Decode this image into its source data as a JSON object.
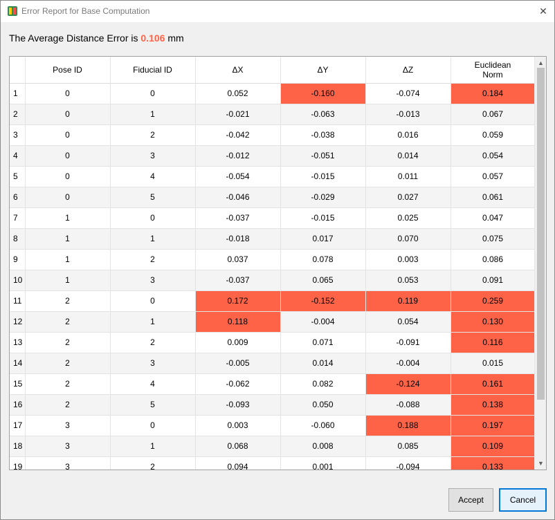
{
  "window": {
    "title": "Error Report for Base Computation"
  },
  "summary": {
    "prefix": "The Average Distance Error is",
    "value": "0.106",
    "unit": "mm"
  },
  "table": {
    "headers": [
      "",
      "Pose ID",
      "Fiducial ID",
      "ΔX",
      "ΔY",
      "ΔZ",
      "Euclidean Norm"
    ],
    "rows": [
      {
        "n": "1",
        "cells": [
          "0",
          "0",
          "0.052",
          "-0.160",
          "-0.074",
          "0.184"
        ],
        "hl": [
          false,
          false,
          false,
          true,
          false,
          true
        ]
      },
      {
        "n": "2",
        "cells": [
          "0",
          "1",
          "-0.021",
          "-0.063",
          "-0.013",
          "0.067"
        ],
        "hl": [
          false,
          false,
          false,
          false,
          false,
          false
        ]
      },
      {
        "n": "3",
        "cells": [
          "0",
          "2",
          "-0.042",
          "-0.038",
          "0.016",
          "0.059"
        ],
        "hl": [
          false,
          false,
          false,
          false,
          false,
          false
        ]
      },
      {
        "n": "4",
        "cells": [
          "0",
          "3",
          "-0.012",
          "-0.051",
          "0.014",
          "0.054"
        ],
        "hl": [
          false,
          false,
          false,
          false,
          false,
          false
        ]
      },
      {
        "n": "5",
        "cells": [
          "0",
          "4",
          "-0.054",
          "-0.015",
          "0.011",
          "0.057"
        ],
        "hl": [
          false,
          false,
          false,
          false,
          false,
          false
        ]
      },
      {
        "n": "6",
        "cells": [
          "0",
          "5",
          "-0.046",
          "-0.029",
          "0.027",
          "0.061"
        ],
        "hl": [
          false,
          false,
          false,
          false,
          false,
          false
        ]
      },
      {
        "n": "7",
        "cells": [
          "1",
          "0",
          "-0.037",
          "-0.015",
          "0.025",
          "0.047"
        ],
        "hl": [
          false,
          false,
          false,
          false,
          false,
          false
        ]
      },
      {
        "n": "8",
        "cells": [
          "1",
          "1",
          "-0.018",
          "0.017",
          "0.070",
          "0.075"
        ],
        "hl": [
          false,
          false,
          false,
          false,
          false,
          false
        ]
      },
      {
        "n": "9",
        "cells": [
          "1",
          "2",
          "0.037",
          "0.078",
          "0.003",
          "0.086"
        ],
        "hl": [
          false,
          false,
          false,
          false,
          false,
          false
        ]
      },
      {
        "n": "10",
        "cells": [
          "1",
          "3",
          "-0.037",
          "0.065",
          "0.053",
          "0.091"
        ],
        "hl": [
          false,
          false,
          false,
          false,
          false,
          false
        ]
      },
      {
        "n": "11",
        "cells": [
          "2",
          "0",
          "0.172",
          "-0.152",
          "0.119",
          "0.259"
        ],
        "hl": [
          false,
          false,
          true,
          true,
          true,
          true
        ]
      },
      {
        "n": "12",
        "cells": [
          "2",
          "1",
          "0.118",
          "-0.004",
          "0.054",
          "0.130"
        ],
        "hl": [
          false,
          false,
          true,
          false,
          false,
          true
        ]
      },
      {
        "n": "13",
        "cells": [
          "2",
          "2",
          "0.009",
          "0.071",
          "-0.091",
          "0.116"
        ],
        "hl": [
          false,
          false,
          false,
          false,
          false,
          true
        ]
      },
      {
        "n": "14",
        "cells": [
          "2",
          "3",
          "-0.005",
          "0.014",
          "-0.004",
          "0.015"
        ],
        "hl": [
          false,
          false,
          false,
          false,
          false,
          false
        ]
      },
      {
        "n": "15",
        "cells": [
          "2",
          "4",
          "-0.062",
          "0.082",
          "-0.124",
          "0.161"
        ],
        "hl": [
          false,
          false,
          false,
          false,
          true,
          true
        ]
      },
      {
        "n": "16",
        "cells": [
          "2",
          "5",
          "-0.093",
          "0.050",
          "-0.088",
          "0.138"
        ],
        "hl": [
          false,
          false,
          false,
          false,
          false,
          true
        ]
      },
      {
        "n": "17",
        "cells": [
          "3",
          "0",
          "0.003",
          "-0.060",
          "0.188",
          "0.197"
        ],
        "hl": [
          false,
          false,
          false,
          false,
          true,
          true
        ]
      },
      {
        "n": "18",
        "cells": [
          "3",
          "1",
          "0.068",
          "0.008",
          "0.085",
          "0.109"
        ],
        "hl": [
          false,
          false,
          false,
          false,
          false,
          true
        ]
      },
      {
        "n": "19",
        "cells": [
          "3",
          "2",
          "0.094",
          "0.001",
          "-0.094",
          "0.133"
        ],
        "hl": [
          false,
          false,
          false,
          false,
          false,
          true
        ]
      }
    ]
  },
  "buttons": {
    "accept": "Accept",
    "cancel": "Cancel"
  },
  "colors": {
    "highlight": "#ff6347",
    "accent": "#0078d7"
  },
  "icons": {
    "app": "app-icon",
    "close": "close-icon",
    "scroll_up": "chevron-up-icon",
    "scroll_down": "chevron-down-icon"
  }
}
